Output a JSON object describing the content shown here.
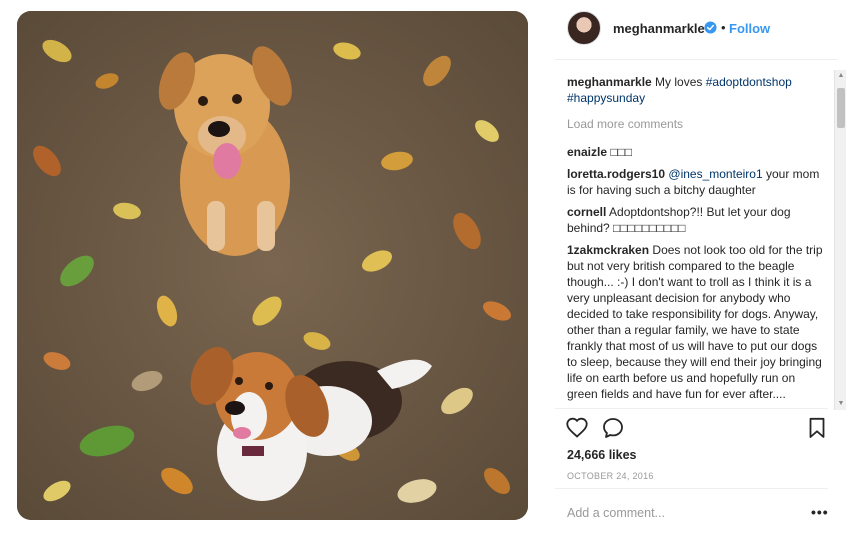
{
  "header": {
    "username": "meghanmarkle",
    "separator": "•",
    "follow_label": "Follow"
  },
  "caption": {
    "username": "meghanmarkle",
    "text": "My loves",
    "hashtags": [
      "#adoptdontshop",
      "#happysunday"
    ]
  },
  "load_more_label": "Load more comments",
  "comments": [
    {
      "user": "enaizle",
      "text": "□□□",
      "mention": ""
    },
    {
      "user": "loretta.rodgers10",
      "mention": "@ines_monteiro1",
      "text": "your mom is for having such a bitchy daughter"
    },
    {
      "user": "cornell",
      "mention": "",
      "text": "Adoptdontshop?!! But let your dog behind? □□□□□□□□□□"
    },
    {
      "user": "1zakmckraken",
      "mention": "",
      "text": "Does not look too old for the trip but not very british compared to the beagle though... :-) I don't want to troll as I think it is a very unpleasant decision for anybody who decided to take responsibility for dogs. Anyway, other than a regular family, we have to state frankly that most of us will have to put our dogs to sleep, because they will end their joy bringing life on earth before us and hopefully run on green fields and have fun for ever after...."
    }
  ],
  "likes": "24,666 likes",
  "date": "OCTOBER 24, 2016",
  "add_comment_placeholder": "Add a comment...",
  "more_label": "•••",
  "icons": {
    "verified": "verified-badge-icon",
    "like": "heart-icon",
    "comment": "comment-bubble-icon",
    "save": "bookmark-icon",
    "more": "more-options-icon"
  },
  "colors": {
    "link": "#3897f0",
    "hashtag": "#003569",
    "muted": "#999999",
    "text": "#262626"
  }
}
